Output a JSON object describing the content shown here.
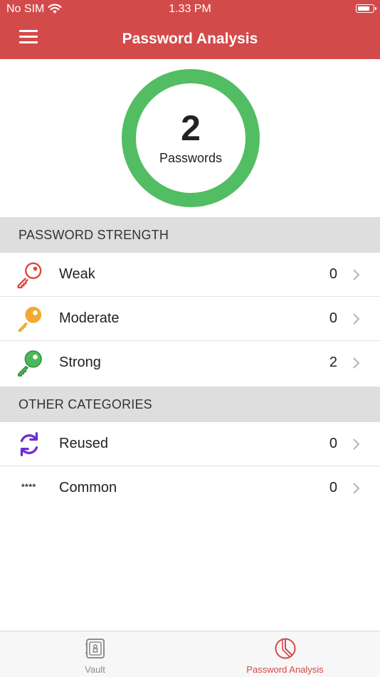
{
  "status_bar": {
    "carrier": "No SIM",
    "time": "1.33 PM"
  },
  "header": {
    "title": "Password Analysis"
  },
  "summary": {
    "count": "2",
    "label": "Passwords",
    "ring_color": "#52bd62"
  },
  "strength_section": {
    "title": "PASSWORD STRENGTH",
    "items": [
      {
        "label": "Weak",
        "count": "0",
        "icon": "key-icon",
        "color": "#e0463c"
      },
      {
        "label": "Moderate",
        "count": "0",
        "icon": "key-icon",
        "color": "#f2a933"
      },
      {
        "label": "Strong",
        "count": "2",
        "icon": "key-icon",
        "color": "#4cb85a"
      }
    ]
  },
  "other_section": {
    "title": "OTHER CATEGORIES",
    "items": [
      {
        "label": "Reused",
        "count": "0",
        "icon": "refresh-icon",
        "color": "#6a2fd1"
      },
      {
        "label": "Common",
        "count": "0",
        "icon": "asterisks-icon",
        "glyph": "****",
        "color": "#333333"
      }
    ]
  },
  "tabbar": {
    "tabs": [
      {
        "label": "Vault",
        "icon": "vault-icon",
        "active": false,
        "color": "#8e8e8e"
      },
      {
        "label": "Password Analysis",
        "icon": "pie-chart-icon",
        "active": true,
        "color": "#d34a4a"
      }
    ]
  },
  "colors": {
    "header_bg": "#d34a4a",
    "section_bg": "#dedede"
  }
}
